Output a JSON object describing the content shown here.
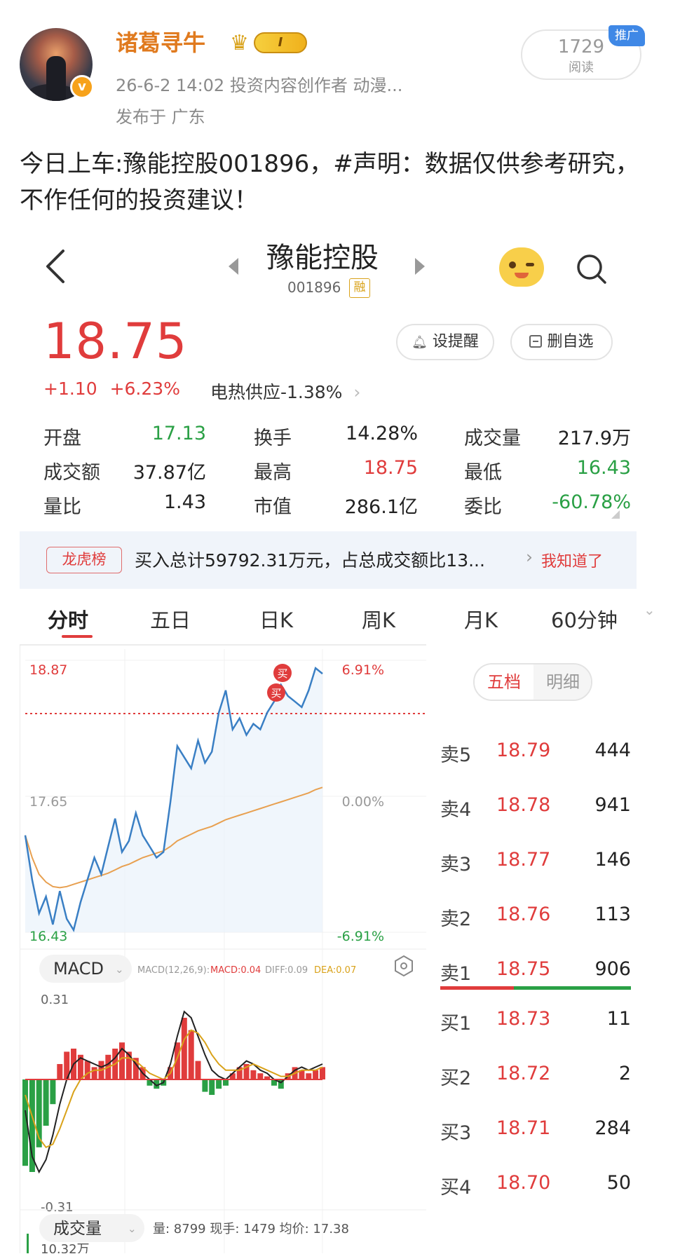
{
  "post": {
    "username": "诸葛寻牛",
    "level_badge": "I",
    "verified_mark": "v",
    "meta_line1": "26-6-2 14:02   投资内容创作者 动漫...",
    "meta_line2": "发布于 广东",
    "read_count": "1729",
    "read_label": "阅读",
    "promo_tag": "推广",
    "text": "今日上车:豫能控股001896，#声明：数据仅供参考研究，不作任何的投资建议！"
  },
  "stock": {
    "name": "豫能控股",
    "code": "001896",
    "margin_tag": "融",
    "price": "18.75",
    "change": "+1.10",
    "change_pct": "+6.23%",
    "sector": "电热供应-1.38%",
    "sector_chevron": "›",
    "alert_label": "设提醒",
    "delete_label": "删自选",
    "alert_icon": "bell-icon",
    "stats": [
      {
        "label": "开盘",
        "value": "17.13",
        "color": "green"
      },
      {
        "label": "换手",
        "value": "14.28%",
        "color": "black"
      },
      {
        "label": "成交量",
        "value": "217.9万",
        "color": "black"
      },
      {
        "label": "成交额",
        "value": "37.87亿",
        "color": "black"
      },
      {
        "label": "最高",
        "value": "18.75",
        "color": "red"
      },
      {
        "label": "最低",
        "value": "16.43",
        "color": "green"
      },
      {
        "label": "量比",
        "value": "1.43",
        "color": "black"
      },
      {
        "label": "市值",
        "value": "286.1亿",
        "color": "black"
      },
      {
        "label": "委比",
        "value": "-60.78%",
        "color": "green"
      }
    ]
  },
  "lhb": {
    "tag": "龙虎榜",
    "text": "买入总计59792.31万元，占总成交额比13...",
    "arrow": "›",
    "action": "我知道了"
  },
  "tabs": [
    "分时",
    "五日",
    "日K",
    "周K",
    "月K",
    "60分钟"
  ],
  "tab_more": "⌄",
  "chart": {
    "price_high_label": "18.87",
    "price_mid_label": "17.65",
    "price_low_label": "16.43",
    "pct_high_label": "6.91%",
    "pct_mid_label": "0.00%",
    "pct_low_label": "-6.91%",
    "buy_marker": "买",
    "macd_title": "MACD",
    "macd_params": "MACD(12,26,9):",
    "macd_value": "MACD:0.04",
    "diff_value": "DIFF:0.09",
    "dea_value": "DEA:0.07",
    "macd_high": "0.31",
    "macd_low": "-0.31",
    "vol_title": "成交量",
    "vol_stats": "量: 8799   现手: 1479   均价: 17.38",
    "vol_high": "10.32万",
    "colors": {
      "price_line": "#3a7fc4",
      "avg_line": "#e8a050",
      "up": "#e03c3c",
      "down": "#2aa045"
    }
  },
  "chart_data": {
    "type": "line",
    "title": "",
    "ylim": [
      16.43,
      18.87
    ],
    "series": [
      {
        "values": [
          17.3,
          16.9,
          16.6,
          16.75,
          16.5,
          16.8,
          16.55,
          16.45,
          16.7,
          16.9,
          17.1,
          16.95,
          17.2,
          17.45,
          17.15,
          17.25,
          17.5,
          17.3,
          17.2,
          17.1,
          17.15,
          17.6,
          18.1,
          18.0,
          17.9,
          18.15,
          17.95,
          18.05,
          18.4,
          18.6,
          18.25,
          18.35,
          18.2,
          18.3,
          18.25,
          18.4,
          18.5,
          18.65,
          18.55,
          18.5,
          18.45,
          18.6,
          18.8,
          18.75
        ]
      },
      {
        "values": [
          17.3,
          17.1,
          16.95,
          16.88,
          16.84,
          16.83,
          16.84,
          16.86,
          16.88,
          16.9,
          16.92,
          16.94,
          16.96,
          16.99,
          17.02,
          17.04,
          17.07,
          17.1,
          17.12,
          17.14,
          17.16,
          17.2,
          17.25,
          17.28,
          17.31,
          17.34,
          17.36,
          17.38,
          17.41,
          17.44,
          17.46,
          17.48,
          17.5,
          17.52,
          17.54,
          17.56,
          17.58,
          17.6,
          17.62,
          17.64,
          17.66,
          17.68,
          17.71,
          17.73
        ]
      }
    ]
  },
  "orderbook": {
    "tab_active": "五档",
    "tab_other": "明细",
    "asks": [
      {
        "label": "卖5",
        "price": "18.79",
        "qty": "444"
      },
      {
        "label": "卖4",
        "price": "18.78",
        "qty": "941"
      },
      {
        "label": "卖3",
        "price": "18.77",
        "qty": "146"
      },
      {
        "label": "卖2",
        "price": "18.76",
        "qty": "113"
      },
      {
        "label": "卖1",
        "price": "18.75",
        "qty": "906"
      }
    ],
    "bids": [
      {
        "label": "买1",
        "price": "18.73",
        "qty": "11"
      },
      {
        "label": "买2",
        "price": "18.72",
        "qty": "2"
      },
      {
        "label": "买3",
        "price": "18.71",
        "qty": "284"
      },
      {
        "label": "买4",
        "price": "18.70",
        "qty": "50"
      }
    ]
  }
}
